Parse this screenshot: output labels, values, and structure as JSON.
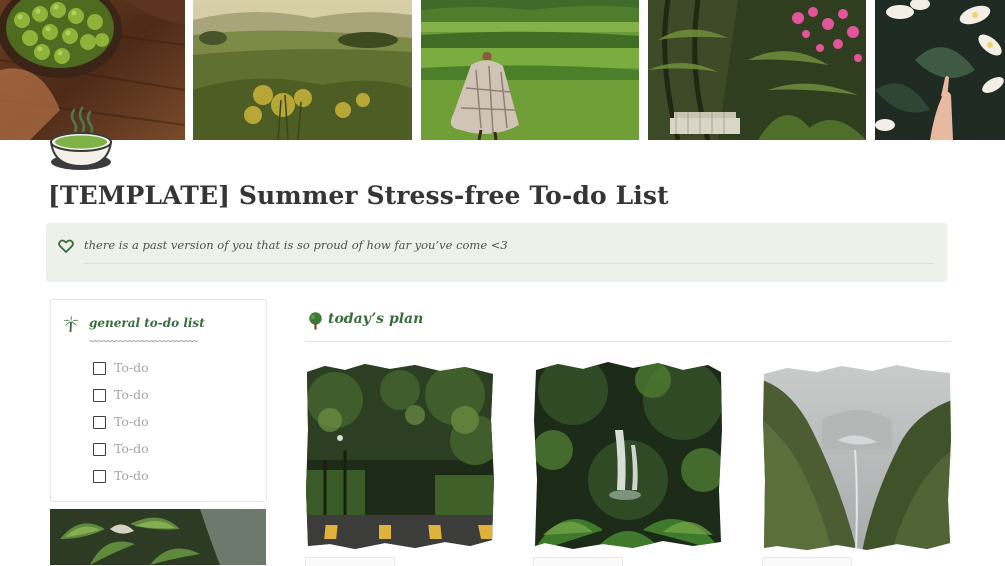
{
  "page": {
    "title": "[TEMPLATE] Summer Stress-free To-do List",
    "icon": "matcha-bowl-icon",
    "cover_images": [
      "green-olives-bowl-photo",
      "hill-meadow-photo",
      "woman-in-field-photo",
      "tropical-garden-photo",
      "white-flowers-hand-photo"
    ]
  },
  "callout": {
    "icon": "heart-outline-icon",
    "text": "there is a past version of you that is so proud of how far you’ve come <3"
  },
  "todo_list": {
    "icon": "palm-tree-icon",
    "title": "general to-do list",
    "divider": "~~~~~~~~~~~~~~~~~~~~~~~~~",
    "items": [
      {
        "label": "To-do",
        "checked": false
      },
      {
        "label": "To-do",
        "checked": false
      },
      {
        "label": "To-do",
        "checked": false
      },
      {
        "label": "To-do",
        "checked": false
      },
      {
        "label": "To-do",
        "checked": false
      }
    ]
  },
  "plan": {
    "icon": "tree-icon",
    "title": "today’s plan",
    "images": [
      "forest-road-photo",
      "jungle-waterfall-photo",
      "misty-valley-photo"
    ]
  },
  "colors": {
    "accent_green": "#3a6b3d",
    "callout_bg": "#edf1ea",
    "placeholder_text": "#a4a4a4"
  }
}
